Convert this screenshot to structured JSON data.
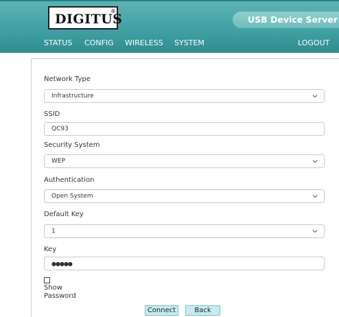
{
  "header": {
    "logo_text": "DIGITUS",
    "logo_mark": "®",
    "product_name": "USB Device Server",
    "nav": {
      "status": "STATUS",
      "config": "CONFIG",
      "wireless": "WIRELESS",
      "system": "SYSTEM",
      "logout": "LOGOUT"
    }
  },
  "form": {
    "network_type": {
      "label": "Network Type",
      "value": "Infrastructure"
    },
    "ssid": {
      "label": "SSID",
      "value": "QC93"
    },
    "security_system": {
      "label": "Security System",
      "value": "WEP"
    },
    "authentication": {
      "label": "Authentication",
      "value": "Open System"
    },
    "default_key": {
      "label": "Default Key",
      "value": "1"
    },
    "key": {
      "label": "Key",
      "value": "●●●●●"
    },
    "show_password": {
      "line1": "Show",
      "line2": "Password",
      "checked": false
    }
  },
  "buttons": {
    "connect": "Connect",
    "back": "Back"
  },
  "icons": {
    "dropdown": "chevron-down-icon"
  },
  "colors": {
    "header_teal": "#3f9fa1",
    "product_pill": "#8fd0cf",
    "button_bg": "#c9ecee",
    "button_border": "#7bbfc3"
  }
}
